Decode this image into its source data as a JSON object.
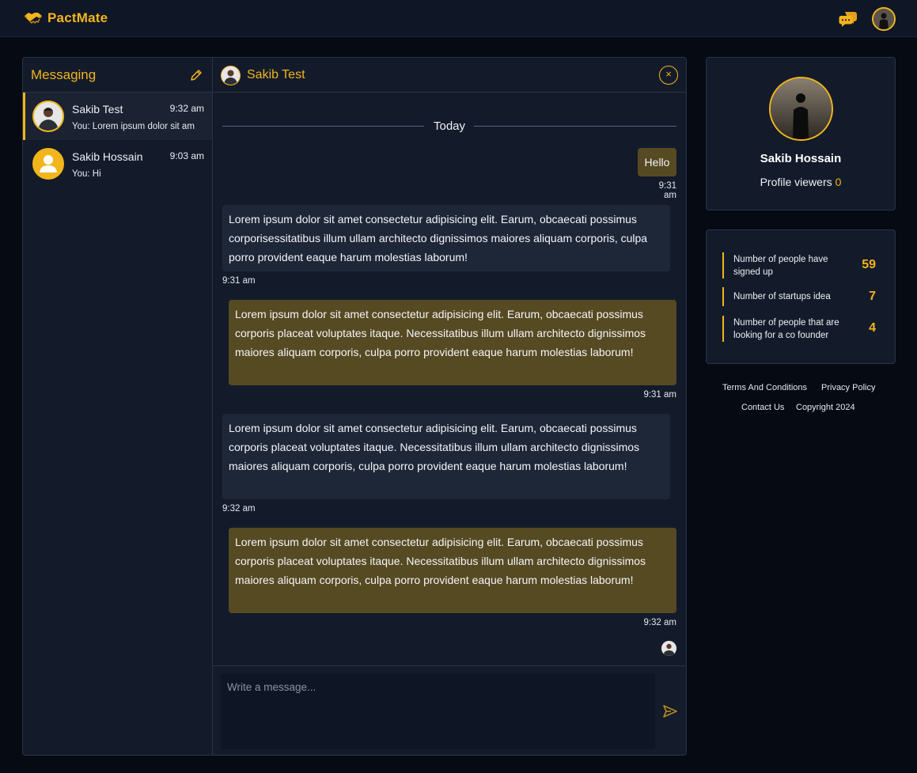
{
  "app": {
    "name": "PactMate"
  },
  "header": {
    "chat_icon": "chat-bubbles-icon",
    "avatar": "user-avatar"
  },
  "messaging": {
    "title": "Messaging",
    "conversations": [
      {
        "name": "Sakib Test",
        "time": "9:32 am",
        "preview": "You: Lorem ipsum dolor sit am"
      },
      {
        "name": "Sakib Hossain",
        "time": "9:03 am",
        "preview": "You: Hi"
      }
    ]
  },
  "chat": {
    "contact": "Sakib Test",
    "close_label": "×",
    "day_label": "Today",
    "messages": [
      {
        "direction": "out",
        "text": "Hello",
        "time": "9:31 am"
      },
      {
        "direction": "in",
        "text": "Lorem ipsum dolor sit amet consectetur adipisicing elit. Earum, obcaecati possimus corporisessitatibus illum ullam architecto dignissimos maiores aliquam corporis, culpa porro provident eaque harum molestias laborum!",
        "time": "9:31 am"
      },
      {
        "direction": "out",
        "text": "Lorem ipsum dolor sit amet consectetur adipisicing elit. Earum, obcaecati possimus corporis placeat voluptates itaque. Necessitatibus illum ullam architecto dignissimos maiores aliquam corporis, culpa porro provident eaque harum molestias laborum!",
        "time": "9:31 am"
      },
      {
        "direction": "in",
        "text": "Lorem ipsum dolor sit amet consectetur adipisicing elit. Earum, obcaecati possimus corporis placeat voluptates itaque. Necessitatibus illum ullam architecto dignissimos maiores aliquam corporis, culpa porro provident eaque harum molestias laborum!",
        "time": "9:32 am"
      },
      {
        "direction": "out",
        "text": "Lorem ipsum dolor sit amet consectetur adipisicing elit. Earum, obcaecati possimus corporis placeat voluptates itaque. Necessitatibus illum ullam architecto dignissimos maiores aliquam corporis, culpa porro provident eaque harum molestias laborum!",
        "time": "9:32 am"
      }
    ],
    "input_placeholder": "Write a message..."
  },
  "profile": {
    "name": "Sakib Hossain",
    "viewers_label": "Profile viewers",
    "viewers_count": "0"
  },
  "stats": [
    {
      "label": "Number of people have signed up",
      "value": "59"
    },
    {
      "label": "Number of startups idea",
      "value": "7"
    },
    {
      "label": "Number of people that are looking for a co founder",
      "value": "4"
    }
  ],
  "footer": {
    "terms": "Terms And Conditions",
    "privacy": "Privacy Policy",
    "contact": "Contact Us",
    "copyright": "Copyright 2024"
  },
  "colors": {
    "accent": "#f2b51b",
    "background": "#050a13",
    "panel": "#131b2b",
    "outgoing_bubble": "#564a23",
    "incoming_bubble": "#1e2738"
  }
}
